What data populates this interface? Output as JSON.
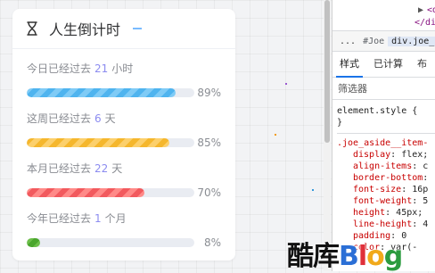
{
  "card": {
    "title": "人生倒计时",
    "items": [
      {
        "prefix": "今日已经过去",
        "value": "21",
        "unit": "小时",
        "percent": 89,
        "percent_label": "89%",
        "color": "blue"
      },
      {
        "prefix": "这周已经过去",
        "value": "6",
        "unit": "天",
        "percent": 85,
        "percent_label": "85%",
        "color": "yellow"
      },
      {
        "prefix": "本月已经过去",
        "value": "22",
        "unit": "天",
        "percent": 70,
        "percent_label": "70%",
        "color": "red"
      },
      {
        "prefix": "今年已经过去",
        "value": "1",
        "unit": "个月",
        "percent": 8,
        "percent_label": "8%",
        "color": "green"
      }
    ]
  },
  "devtools": {
    "dom_lines": [
      "<di",
      "</di"
    ],
    "breadcrumbs": [
      "...",
      "#Joe",
      "div.joe_co"
    ],
    "tabs": [
      "样式",
      "已计算",
      "布"
    ],
    "filter_placeholder": "筛选器",
    "element_style_header": "element.style {",
    "element_style_close": "}",
    "rule_selector": ".joe_aside__item-",
    "rule_props": [
      {
        "name": "display",
        "value": "flex;"
      },
      {
        "name": "align-items",
        "value": "c"
      },
      {
        "name": "border-bottom",
        "value": ""
      },
      {
        "name": "font-size",
        "value": "16p"
      },
      {
        "name": "font-weight",
        "value": "5"
      },
      {
        "name": "height",
        "value": "45px;"
      },
      {
        "name": "line-height",
        "value": "4"
      },
      {
        "name": "padding",
        "value": "0"
      },
      {
        "name": "color",
        "value": "var(-"
      }
    ]
  },
  "watermark": {
    "text": "酷库Blog"
  },
  "colors": {
    "blue": "#4fb4ef",
    "yellow": "#f5b72d",
    "red": "#f25a5e",
    "green": "#4aa62d",
    "accent_number": "#8c8cf0"
  }
}
